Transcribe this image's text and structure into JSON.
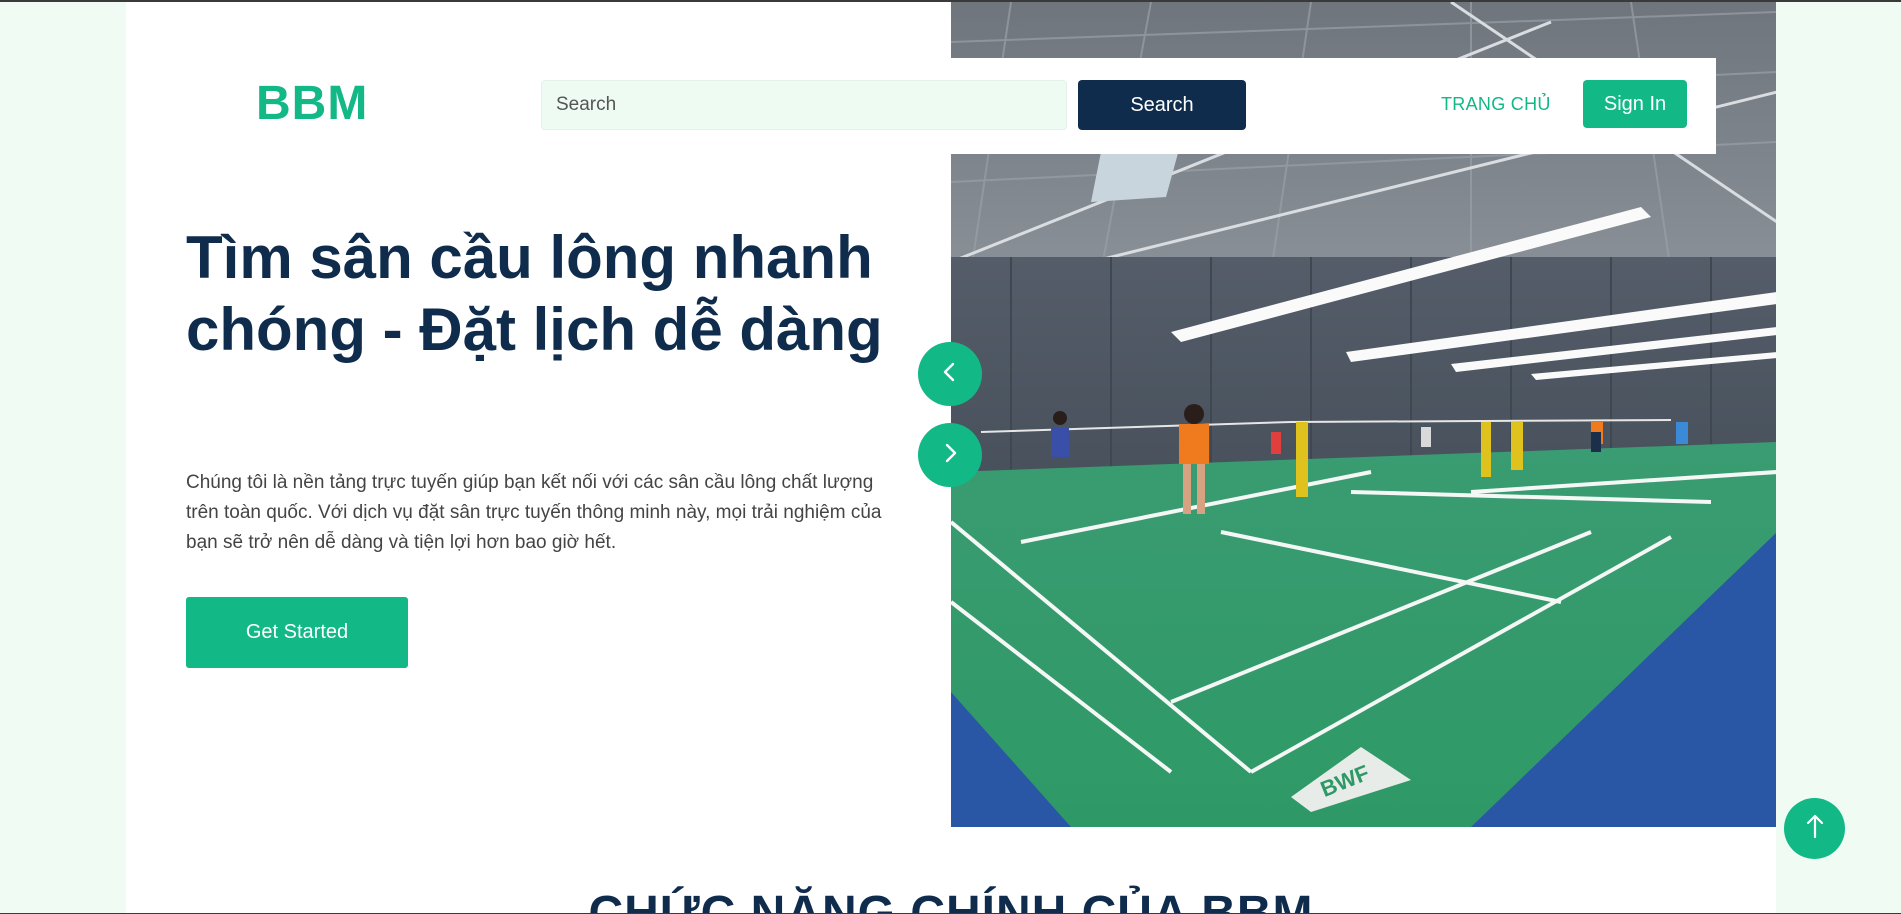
{
  "logo": "BBM",
  "search": {
    "placeholder": "Search",
    "button_label": "Search"
  },
  "nav": {
    "home_label": "TRANG CHỦ",
    "signin_label": "Sign In"
  },
  "hero": {
    "title": "Tìm sân cầu lông nhanh chóng - Đặt lịch dễ dàng",
    "description": "Chúng tôi là nền tảng trực tuyến giúp bạn kết nối với các sân cầu lông chất lượng trên toàn quốc. Với dịch vụ đặt sân trực tuyến thông minh này, mọi trải nghiệm của bạn sẽ trở nên dễ dàng và tiện lợi hơn bao giờ hết.",
    "cta_label": "Get Started",
    "image_court_mark": "BWF"
  },
  "section": {
    "title": "CHỨC NĂNG CHÍNH CỦA BBM"
  },
  "icons": {
    "prev": "chevron-left-icon",
    "next": "chevron-right-icon",
    "back_to_top": "arrow-up-icon"
  },
  "colors": {
    "accent": "#12b886",
    "navy": "#0f2c4d",
    "page_bg": "#effbf3",
    "input_bg": "#eefbf3",
    "court_green": "#2e9f6c",
    "court_blue": "#2a56a6"
  }
}
